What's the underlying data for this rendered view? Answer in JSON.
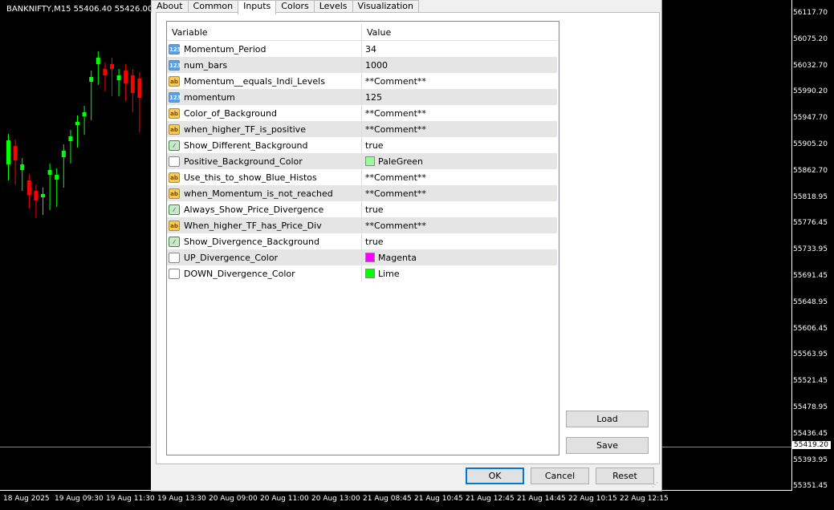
{
  "chart": {
    "title": "BANKNIFTY,M15  55406.40 55426.00 554",
    "current_price": "55419.20",
    "price_labels": [
      "56117.70",
      "56075.20",
      "56032.70",
      "55990.20",
      "55947.70",
      "55905.20",
      "55862.70",
      "55818.95",
      "55776.45",
      "55733.95",
      "55691.45",
      "55648.95",
      "55606.45",
      "55563.95",
      "55521.45",
      "55478.95",
      "55436.45",
      "55393.95",
      "55351.45"
    ],
    "time_labels": [
      "18 Aug 2025",
      "19 Aug 09:30",
      "19 Aug 11:30",
      "19 Aug 13:30",
      "20 Aug 09:00",
      "20 Aug 11:00",
      "20 Aug 13:00",
      "21 Aug 08:45",
      "21 Aug 10:45",
      "21 Aug 12:45",
      "21 Aug 14:45",
      "22 Aug 10:15",
      "22 Aug 12:15"
    ],
    "bull_color": "#00ff00",
    "bear_color": "#ff0000"
  },
  "dialog": {
    "tabs": [
      "About",
      "Common",
      "Inputs",
      "Colors",
      "Levels",
      "Visualization"
    ],
    "active_tab": "Inputs",
    "table": {
      "header_variable": "Variable",
      "header_value": "Value",
      "rows": [
        {
          "icon": "number-icon",
          "name": "Momentum_Period",
          "value": "34"
        },
        {
          "icon": "number-icon",
          "name": "num_bars",
          "value": "1000"
        },
        {
          "icon": "string-icon",
          "name": "Momentum__equals_Indi_Levels",
          "value": "**Comment**"
        },
        {
          "icon": "number-icon",
          "name": "momentum",
          "value": "125"
        },
        {
          "icon": "string-icon",
          "name": "Color_of_Background",
          "value": "**Comment**"
        },
        {
          "icon": "string-icon",
          "name": "when_higher_TF_is_positive",
          "value": "**Comment**"
        },
        {
          "icon": "bool-icon",
          "name": "Show_Different_Background",
          "value": "true"
        },
        {
          "icon": "color-icon",
          "name": "Positive_Background_Color",
          "value": "PaleGreen",
          "swatch": "#98fb98"
        },
        {
          "icon": "string-icon",
          "name": "Use_this_to_show_Blue_Histos",
          "value": "**Comment**"
        },
        {
          "icon": "string-icon",
          "name": "when_Momentum_is_not_reached",
          "value": "**Comment**"
        },
        {
          "icon": "bool-icon",
          "name": "Always_Show_Price_Divergence",
          "value": "true"
        },
        {
          "icon": "string-icon",
          "name": "When_higher_TF_has_Price_Div",
          "value": "**Comment**"
        },
        {
          "icon": "bool-icon",
          "name": "Show_Divergence_Background",
          "value": "true"
        },
        {
          "icon": "color-icon",
          "name": "UP_Divergence_Color",
          "value": "Magenta",
          "swatch": "#ff00ff"
        },
        {
          "icon": "color-icon",
          "name": "DOWN_Divergence_Color",
          "value": "Lime",
          "swatch": "#00ff00"
        }
      ]
    },
    "buttons": {
      "load": "Load",
      "save": "Save",
      "ok": "OK",
      "cancel": "Cancel",
      "reset": "Reset"
    }
  }
}
